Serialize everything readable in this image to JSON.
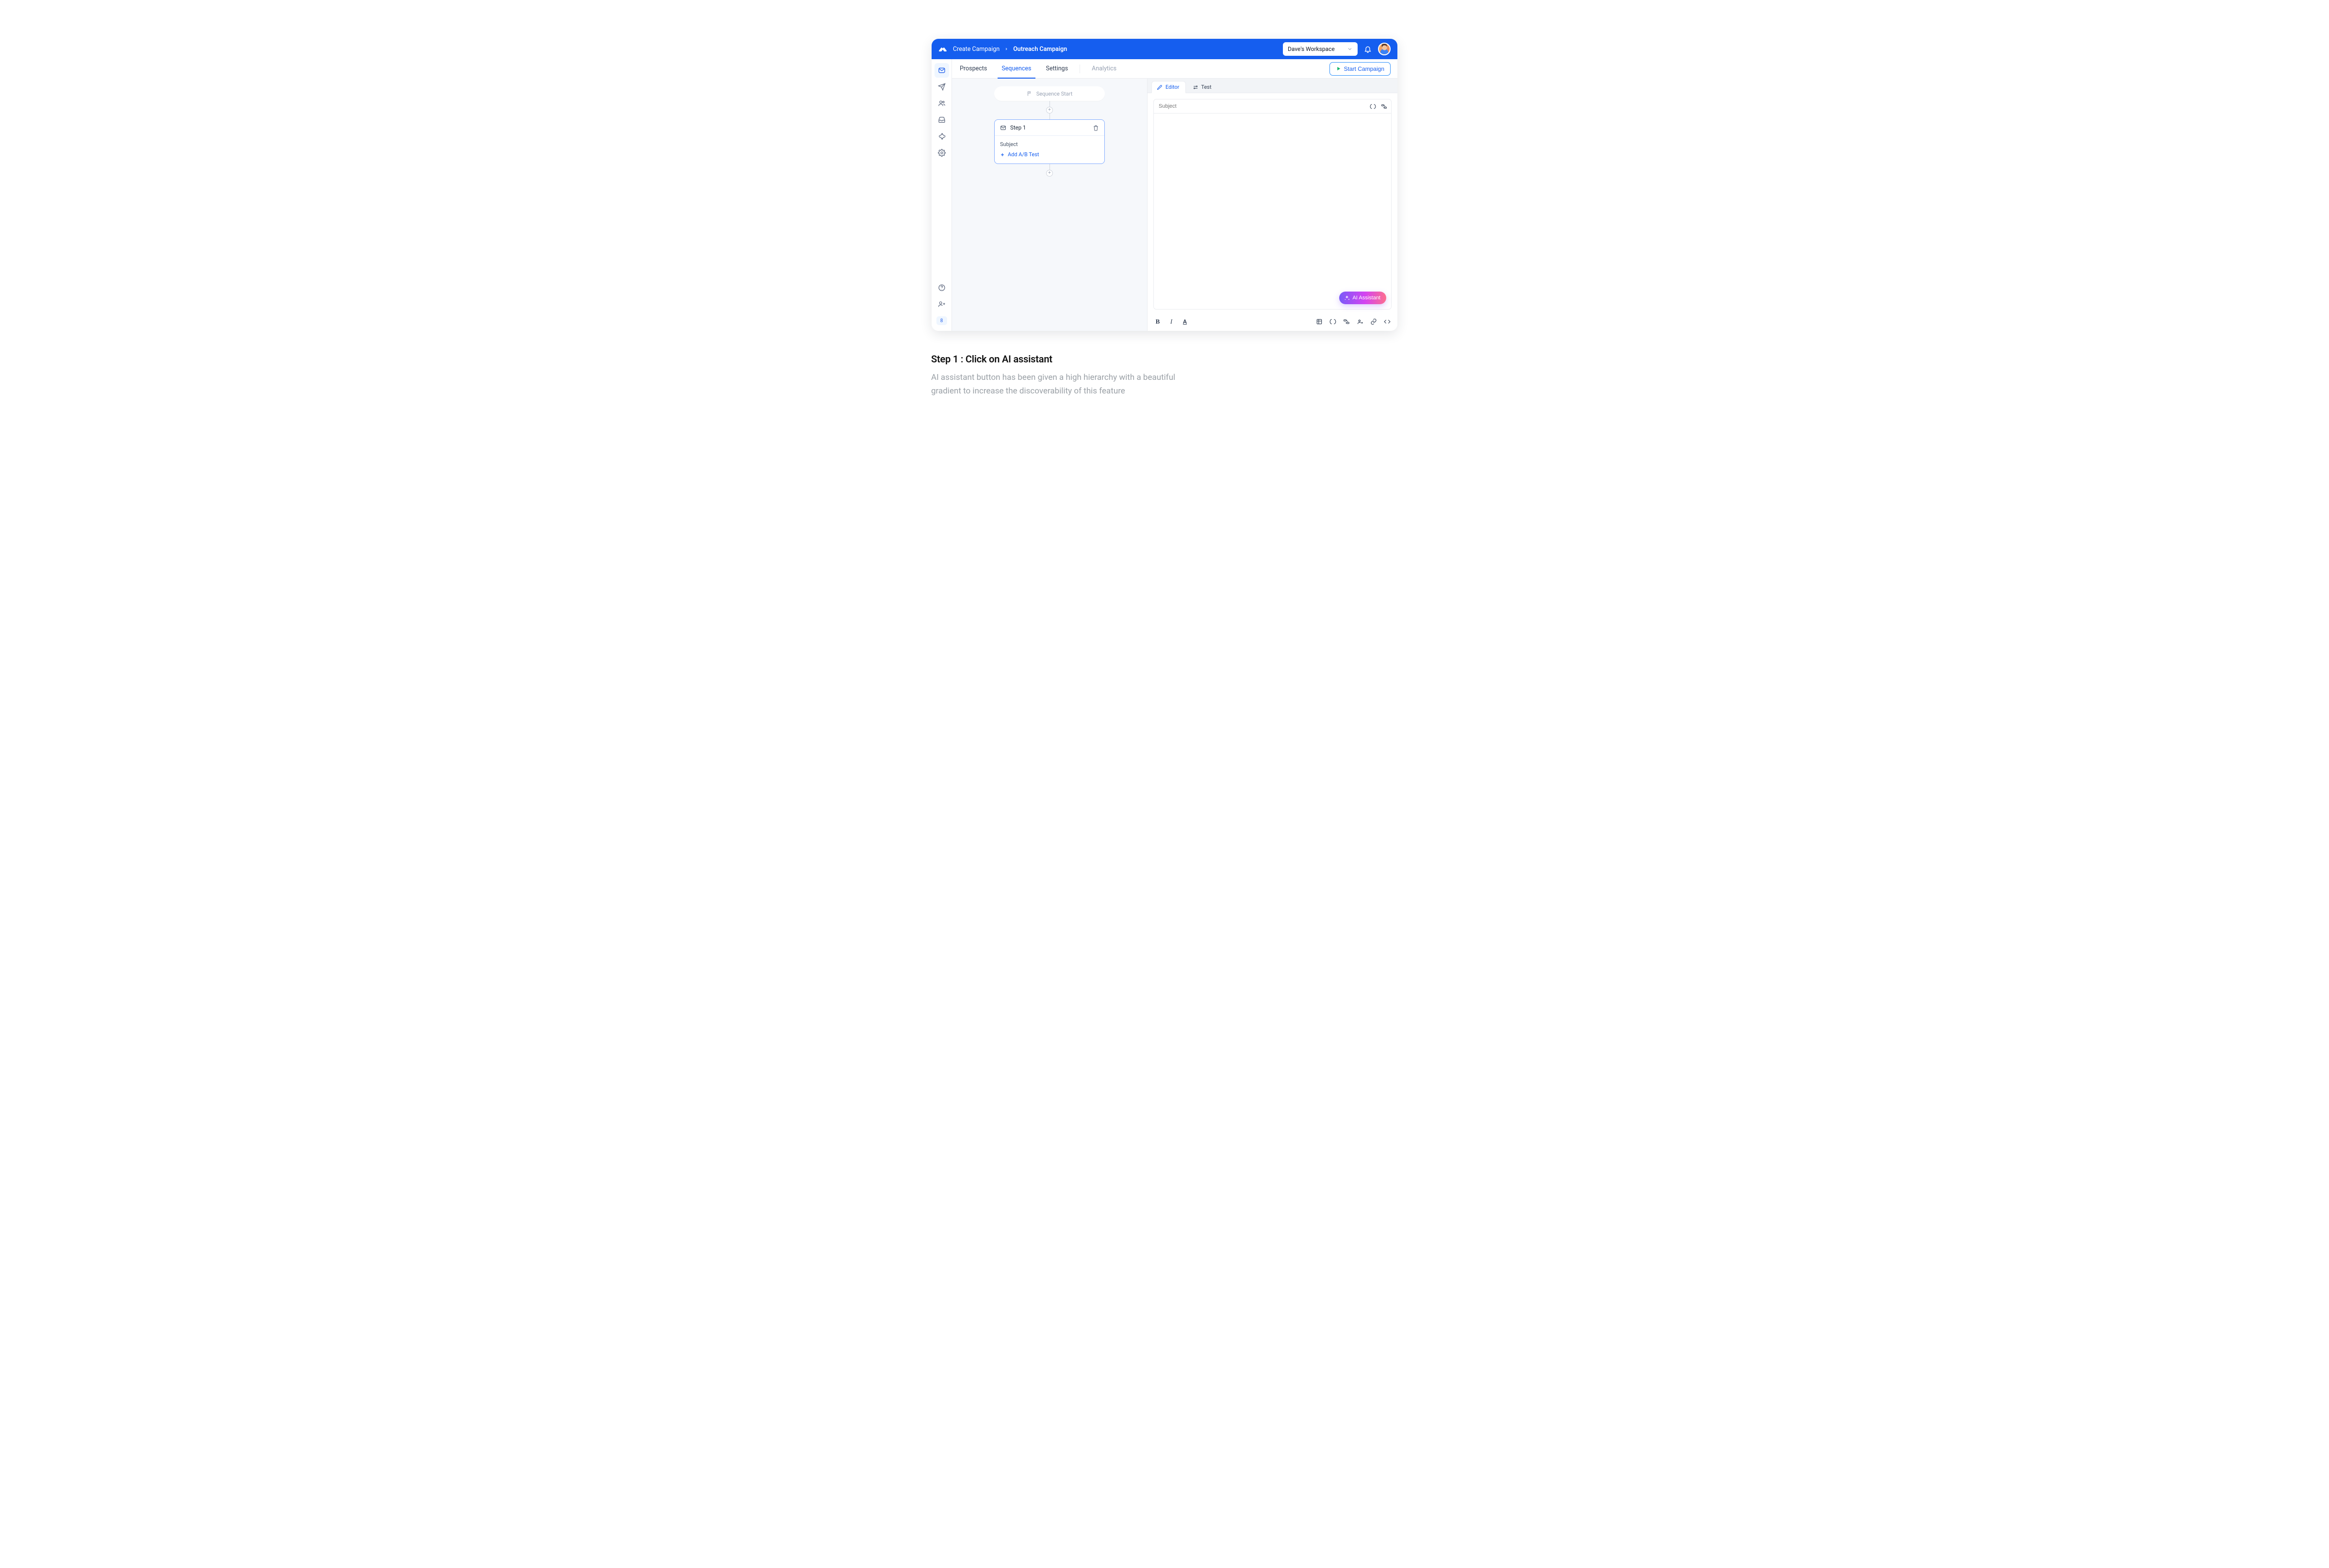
{
  "header": {
    "breadcrumb_parent": "Create Campaign",
    "breadcrumb_current": "Outreach Campaign",
    "workspace": "Dave's Workspace"
  },
  "sidebar": {
    "items": [
      {
        "name": "campaigns",
        "active": true
      },
      {
        "name": "send",
        "active": false
      },
      {
        "name": "contacts",
        "active": false
      },
      {
        "name": "inbox",
        "active": false
      },
      {
        "name": "integrations",
        "active": false
      },
      {
        "name": "settings",
        "active": false
      }
    ],
    "badge": "8"
  },
  "tabs": {
    "items": [
      {
        "key": "prospects",
        "label": "Prospects",
        "active": false,
        "disabled": false
      },
      {
        "key": "sequences",
        "label": "Sequences",
        "active": true,
        "disabled": false
      },
      {
        "key": "settings",
        "label": "Settings",
        "active": false,
        "disabled": false
      },
      {
        "key": "analytics",
        "label": "Analytics",
        "active": false,
        "disabled": true
      }
    ],
    "start_label": "Start Campaign"
  },
  "sequence": {
    "start_label": "Sequence Start",
    "step": {
      "title": "Step 1",
      "subject_label": "Subject",
      "ab_label": "Add A/B Test"
    }
  },
  "editor": {
    "tabs": {
      "editor": "Editor",
      "test": "Test"
    },
    "subject_placeholder": "Subject",
    "ai_label": "AI Assistant"
  },
  "annotation": {
    "title": "Step 1 : Click on AI assistant",
    "body": "AI assistant button  has been given a high hierarchy with a beautiful gradient to increase the discoverability of this feature"
  }
}
